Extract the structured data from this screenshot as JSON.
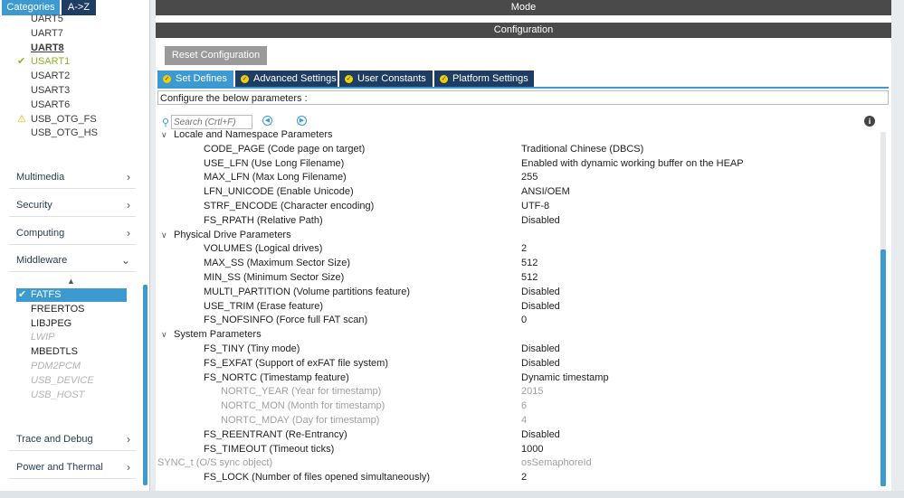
{
  "left_tabs": {
    "categories": "Categories",
    "az": "A->Z"
  },
  "peripherals": [
    {
      "label": "UART5",
      "status": "none"
    },
    {
      "label": "UART7",
      "status": "none"
    },
    {
      "label": "UART8",
      "status": "bold"
    },
    {
      "label": "USART1",
      "status": "check"
    },
    {
      "label": "USART2",
      "status": "none"
    },
    {
      "label": "USART3",
      "status": "none"
    },
    {
      "label": "USART6",
      "status": "none"
    },
    {
      "label": "USB_OTG_FS",
      "status": "warn"
    },
    {
      "label": "USB_OTG_HS",
      "status": "none"
    }
  ],
  "sections": {
    "multimedia": "Multimedia",
    "security": "Security",
    "computing": "Computing",
    "middleware": "Middleware",
    "trace": "Trace and Debug",
    "power": "Power and Thermal"
  },
  "middleware_items": [
    {
      "label": "FATFS",
      "state": "selected"
    },
    {
      "label": "FREERTOS",
      "state": "normal"
    },
    {
      "label": "LIBJPEG",
      "state": "normal"
    },
    {
      "label": "LWIP",
      "state": "disabled"
    },
    {
      "label": "MBEDTLS",
      "state": "normal"
    },
    {
      "label": "PDM2PCM",
      "state": "disabled"
    },
    {
      "label": "USB_DEVICE",
      "state": "disabled"
    },
    {
      "label": "USB_HOST",
      "state": "disabled"
    }
  ],
  "mode_title": "Mode",
  "config_title": "Configuration",
  "reset_button": "Reset Configuration",
  "config_tabs": [
    "Set Defines",
    "Advanced Settings",
    "User Constants",
    "Platform Settings"
  ],
  "config_hint": "Configure the below parameters :",
  "search_placeholder": "Search (Crtl+F)",
  "params": [
    {
      "kind": "grp",
      "name": "Locale and Namespace Parameters",
      "value": ""
    },
    {
      "kind": "p",
      "name": "CODE_PAGE (Code page on target)",
      "value": "Traditional Chinese (DBCS)"
    },
    {
      "kind": "p",
      "name": "USE_LFN (Use Long Filename)",
      "value": "Enabled with dynamic working buffer on the HEAP"
    },
    {
      "kind": "p",
      "name": "MAX_LFN (Max Long Filename)",
      "value": "255"
    },
    {
      "kind": "p",
      "name": "LFN_UNICODE (Enable Unicode)",
      "value": "ANSI/OEM"
    },
    {
      "kind": "p",
      "name": "STRF_ENCODE (Character encoding)",
      "value": "UTF-8"
    },
    {
      "kind": "p",
      "name": "FS_RPATH (Relative Path)",
      "value": "Disabled"
    },
    {
      "kind": "grp",
      "name": "Physical Drive Parameters",
      "value": ""
    },
    {
      "kind": "p",
      "name": "VOLUMES (Logical drives)",
      "value": "2"
    },
    {
      "kind": "p",
      "name": "MAX_SS (Maximum Sector Size)",
      "value": "512"
    },
    {
      "kind": "p",
      "name": "MIN_SS (Minimum Sector Size)",
      "value": "512"
    },
    {
      "kind": "p",
      "name": "MULTI_PARTITION (Volume partitions feature)",
      "value": "Disabled"
    },
    {
      "kind": "p",
      "name": "USE_TRIM (Erase feature)",
      "value": "Disabled"
    },
    {
      "kind": "p",
      "name": "FS_NOFSINFO (Force full FAT scan)",
      "value": "0"
    },
    {
      "kind": "grp",
      "name": "System Parameters",
      "value": ""
    },
    {
      "kind": "p",
      "name": "FS_TINY (Tiny mode)",
      "value": "Disabled"
    },
    {
      "kind": "p",
      "name": "FS_EXFAT (Support of exFAT file system)",
      "value": "Disabled"
    },
    {
      "kind": "p",
      "name": "FS_NORTC (Timestamp feature)",
      "value": "Dynamic timestamp"
    },
    {
      "kind": "sub",
      "name": "NORTC_YEAR (Year for timestamp)",
      "value": "2015"
    },
    {
      "kind": "sub",
      "name": "NORTC_MON (Month for timestamp)",
      "value": "6"
    },
    {
      "kind": "sub",
      "name": "NORTC_MDAY (Day for timestamp)",
      "value": "4"
    },
    {
      "kind": "p",
      "name": "FS_REENTRANT (Re-Entrancy)",
      "value": "Disabled"
    },
    {
      "kind": "p",
      "name": "FS_TIMEOUT (Timeout ticks)",
      "value": "1000"
    },
    {
      "kind": "dis",
      "name": "SYNC_t (O/S sync object)",
      "value": "osSemaphoreId"
    },
    {
      "kind": "p",
      "name": "FS_LOCK (Number of files opened simultaneously)",
      "value": "2"
    }
  ],
  "colors": {
    "accent": "#3d9ad1",
    "navy": "#1e3d63",
    "check": "#8bb51f",
    "warn": "#e6b800"
  },
  "icons": {
    "search": "search-icon",
    "prev": "previous-icon",
    "next": "next-icon",
    "info": "info-icon"
  }
}
